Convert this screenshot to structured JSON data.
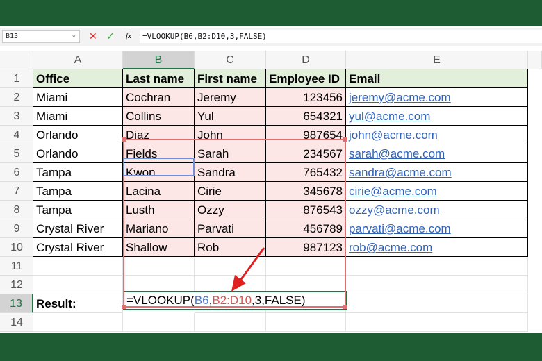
{
  "formula_bar": {
    "name_box": "B13",
    "cancel_icon": "✕",
    "enter_icon": "✓",
    "fx_label": "fx",
    "formula": "=VLOOKUP(B6,B2:D10,3,FALSE)"
  },
  "columns": [
    "A",
    "B",
    "C",
    "D",
    "E"
  ],
  "rows": [
    "1",
    "2",
    "3",
    "4",
    "5",
    "6",
    "7",
    "8",
    "9",
    "10",
    "11",
    "12",
    "13",
    "14"
  ],
  "headers": [
    "Office",
    "Last name",
    "First name",
    "Employee ID",
    "Email"
  ],
  "data": [
    [
      "Miami",
      "Cochran",
      "Jeremy",
      "123456",
      "jeremy@acme.com"
    ],
    [
      "Miami",
      "Collins",
      "Yul",
      "654321",
      "yul@acme.com"
    ],
    [
      "Orlando",
      "Diaz",
      "John",
      "987654",
      "john@acme.com"
    ],
    [
      "Orlando",
      "Fields",
      "Sarah",
      "234567",
      "sarah@acme.com"
    ],
    [
      "Tampa",
      "Kwon",
      "Sandra",
      "765432",
      "sandra@acme.com"
    ],
    [
      "Tampa",
      "Lacina",
      "Cirie",
      "345678",
      "cirie@acme.com"
    ],
    [
      "Tampa",
      "Lusth",
      "Ozzy",
      "876543",
      "ozzy@acme.com"
    ],
    [
      "Crystal River",
      "Mariano",
      "Parvati",
      "456789",
      "parvati@acme.com"
    ],
    [
      "Crystal River",
      "Shallow",
      "Rob",
      "987123",
      "rob@acme.com"
    ]
  ],
  "result": {
    "label": "Result:",
    "f_start": "=VLOOKUP(",
    "f_arg1": "B6",
    "c1": ",",
    "f_arg2": "B2:D10",
    "f_rest": ",3,FALSE)"
  },
  "colors": {
    "brand": "#1e5c34",
    "range": "#e07070",
    "lookup": "#6f8fd8",
    "header_fill": "#e2efda",
    "arrow": "#e02020"
  }
}
